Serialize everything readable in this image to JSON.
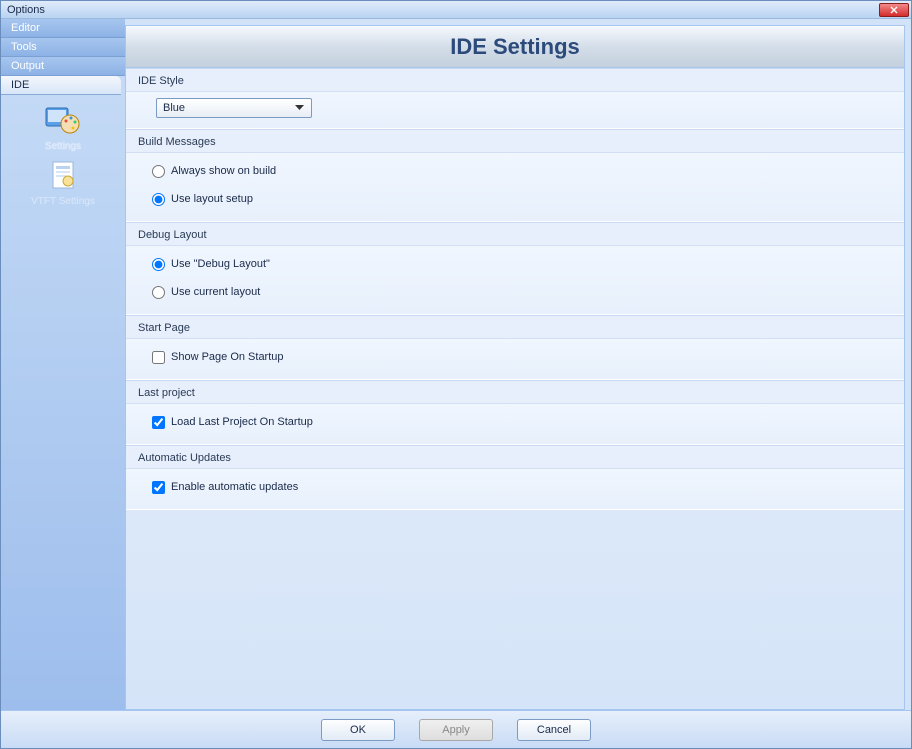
{
  "window": {
    "title": "Options"
  },
  "sidebar": {
    "tabs": [
      "Editor",
      "Tools",
      "Output",
      "IDE"
    ],
    "activeTab": 3,
    "icons": [
      {
        "label": "Settings",
        "key": "settings"
      },
      {
        "label": "VTFT Settings",
        "key": "vtft"
      }
    ]
  },
  "header": {
    "title": "IDE Settings"
  },
  "groups": {
    "ideStyle": {
      "title": "IDE Style",
      "selectValue": "Blue"
    },
    "buildMessages": {
      "title": "Build Messages",
      "opt1": "Always show on build",
      "opt2": "Use layout setup",
      "selected": "opt2"
    },
    "debugLayout": {
      "title": "Debug Layout",
      "opt1": "Use \"Debug Layout\"",
      "opt2": "Use current layout",
      "selected": "opt1"
    },
    "startPage": {
      "title": "Start Page",
      "checkLabel": "Show Page On Startup",
      "checked": false
    },
    "lastProject": {
      "title": "Last project",
      "checkLabel": "Load Last Project On Startup",
      "checked": true
    },
    "autoUpdates": {
      "title": "Automatic Updates",
      "checkLabel": "Enable automatic updates",
      "checked": true
    }
  },
  "footer": {
    "ok": "OK",
    "apply": "Apply",
    "cancel": "Cancel"
  }
}
